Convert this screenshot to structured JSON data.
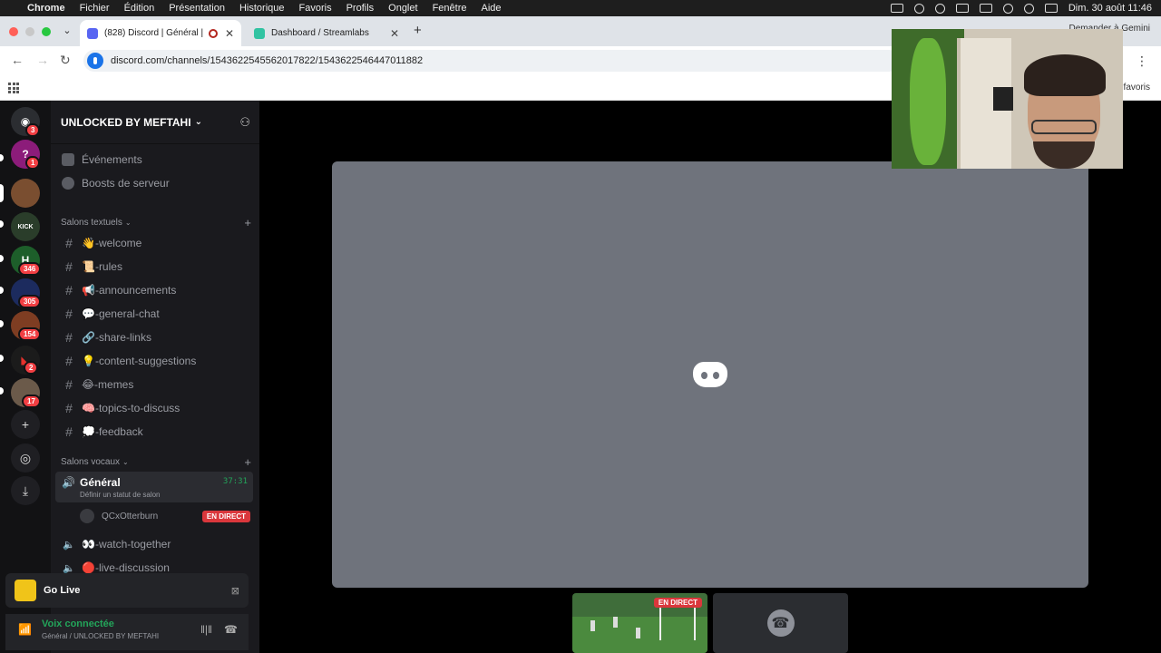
{
  "menubar": {
    "items": [
      "Chrome",
      "Fichier",
      "Édition",
      "Présentation",
      "Historique",
      "Favoris",
      "Profils",
      "Onglet",
      "Fenêtre",
      "Aide"
    ],
    "clock": "Dim. 30 août 11:46"
  },
  "tabs": {
    "active_title": "(828) Discord | Général |",
    "inactive_title": "Dashboard / Streamlabs",
    "gemini_label": "Demander à Gemini"
  },
  "address": {
    "url": "discord.com/channels/1543622545562017822/1543622546447011882"
  },
  "bookmarks": {
    "favoris": "favoris"
  },
  "guilds": [
    {
      "badge": "3",
      "color": "#5865f2",
      "glyph": "◉"
    },
    {
      "badge": "1",
      "color": "#8c1c7a",
      "glyph": "?"
    },
    {
      "badge": "",
      "color": "#7a4e30",
      "glyph": ""
    },
    {
      "badge": "",
      "color": "#2a3d2a",
      "glyph": ""
    },
    {
      "badge": "346",
      "color": "#1d5e2a",
      "glyph": "H"
    },
    {
      "badge": "305",
      "color": "#1c2b5e",
      "glyph": ""
    },
    {
      "badge": "154",
      "color": "#7e3d22",
      "glyph": ""
    },
    {
      "badge": "2",
      "color": "#1b1b1b",
      "glyph": ""
    },
    {
      "badge": "17",
      "color": "#6b5a4a",
      "glyph": ""
    }
  ],
  "server": {
    "name": "UNLOCKED BY MEFTAHI",
    "nav": [
      {
        "label": "Événements"
      },
      {
        "label": "Boosts de serveur"
      }
    ],
    "text_category": "Salons textuels",
    "text_channels": [
      "👋-welcome",
      "📜-rules",
      "📢-announcements",
      "💬-general-chat",
      "🔗-share-links",
      "💡-content-suggestions",
      "😂-memes",
      "🧠-topics-to-discuss",
      "💭-feedback"
    ],
    "voice_category": "Salons vocaux",
    "active_voice": {
      "name": "Général",
      "timer": "37:31",
      "status": "Définir un statut de salon"
    },
    "voice_user": {
      "name": "QCxOtterburn",
      "live": "EN DIRECT"
    },
    "voice_channels": [
      "👀-watch-together",
      "🔴-live-discussion"
    ]
  },
  "golive": {
    "label": "Go Live"
  },
  "voice_connection": {
    "title": "Voix connectée",
    "subtitle": "Général / UNLOCKED BY MEFTAHI"
  },
  "stage": {
    "thumb_live": "EN DIRECT"
  },
  "colors": {
    "accent_green": "#23a55a",
    "live_red": "#da373c",
    "tile_grey": "#6f737c"
  }
}
